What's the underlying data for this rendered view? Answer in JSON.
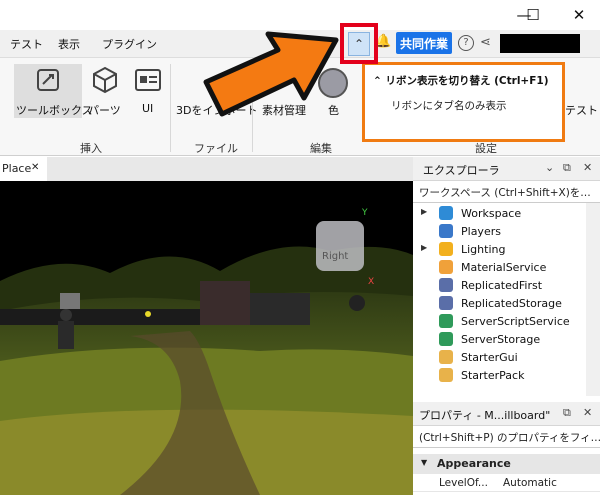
{
  "window": {
    "minimize": "—",
    "maximize": "☐",
    "close": "✕"
  },
  "menu": {
    "items": [
      "テスト",
      "表示",
      "プラグイン"
    ],
    "collab_button": "共同作業",
    "help": "?",
    "ribbon_toggle_icon": "⌃"
  },
  "ribbon": {
    "tools": [
      {
        "label": "ツールボックス",
        "icon": "toolbox-icon"
      },
      {
        "label": "パーツ",
        "icon": "cube-icon"
      },
      {
        "label": "UI",
        "icon": "ui-icon"
      },
      {
        "label": "3Dをインポート",
        "icon": "import-icon"
      },
      {
        "label": "素材管理",
        "icon": "material-icon"
      },
      {
        "label": "色",
        "icon": "color-icon"
      },
      {
        "label": "テスト",
        "icon": "test-icon"
      }
    ],
    "groups": [
      "挿入",
      "ファイル",
      "編集",
      "設定"
    ]
  },
  "callout": {
    "title": "リボン表示を切り替え (Ctrl+F1)",
    "body": "リボンにタブ名のみ表示"
  },
  "viewport": {
    "tab_label": "Place",
    "tab_close": "✕",
    "view_cube_label": "Right"
  },
  "explorer": {
    "title": "エクスプローラ",
    "filter": "ワークスペース (Ctrl+Shift+X)を…",
    "items": [
      {
        "label": "Workspace",
        "expandable": true,
        "color": "#2e8bd6"
      },
      {
        "label": "Players",
        "expandable": false,
        "color": "#3a78c9"
      },
      {
        "label": "Lighting",
        "expandable": true,
        "color": "#f2b01e"
      },
      {
        "label": "MaterialService",
        "expandable": false,
        "color": "#f0a13a"
      },
      {
        "label": "ReplicatedFirst",
        "expandable": false,
        "color": "#5a6ea8"
      },
      {
        "label": "ReplicatedStorage",
        "expandable": false,
        "color": "#5a6ea8"
      },
      {
        "label": "ServerScriptService",
        "expandable": false,
        "color": "#2f9a5a"
      },
      {
        "label": "ServerStorage",
        "expandable": false,
        "color": "#2f9a5a"
      },
      {
        "label": "StarterGui",
        "expandable": false,
        "color": "#e8b24a"
      },
      {
        "label": "StarterPack",
        "expandable": false,
        "color": "#e8b24a"
      }
    ]
  },
  "properties": {
    "title": "プロパティ - M...illboard\"",
    "filter": "(Ctrl+Shift+P) のプロパティをフィ…",
    "section": "Appearance",
    "rows": [
      {
        "name": "LevelOf...",
        "value": "Automatic"
      }
    ]
  }
}
